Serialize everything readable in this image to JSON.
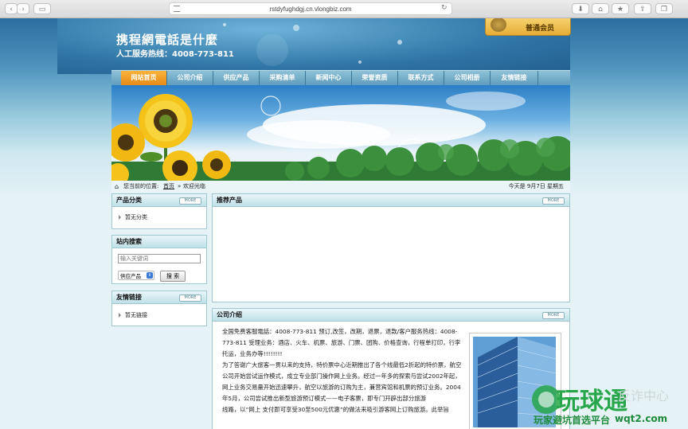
{
  "browser": {
    "url": "rstdyfughdgj.cn.vlongbiz.com"
  },
  "header": {
    "site_title": "携程網電話是什麼",
    "hotline": "人工服务热线：4008-773-811",
    "member_badge": "普通会员"
  },
  "nav": {
    "items": [
      "网站首页",
      "公司介绍",
      "供应产品",
      "采购清单",
      "新闻中心",
      "荣誉资质",
      "联系方式",
      "公司相册",
      "友情链接"
    ],
    "active_index": 0
  },
  "breadcrumb": {
    "prefix": "您当前的位置:",
    "home": "首页",
    "separator": "»",
    "current": "欢迎光临",
    "date_text": "今天是  9月7日  星期五"
  },
  "sidebar": {
    "categories": {
      "title": "产品分类",
      "more": "MORE",
      "items": [
        "暂无分类"
      ]
    },
    "search": {
      "title": "站内搜索",
      "placeholder": "输入关键词",
      "select_value": "供应产品",
      "button": "搜 索"
    },
    "links": {
      "title": "友情链接",
      "more": "MORE",
      "items": [
        "暂无链接"
      ]
    }
  },
  "main": {
    "recommended": {
      "title": "推荐产品",
      "more": "MORE"
    },
    "about": {
      "title": "公司介绍",
      "more": "MORE",
      "paragraphs": [
        "全国免费客服電話：4008-773-811 预订,改签，改期，退票，退款/客户服务热线：4008-773-811 受理业务：酒店、火车、机票、旅游、门票、团购、价格查询，行程单打印，行李托运，业务办等!!!!!!!!",
        "为了答谢广大旅客一贯以来的支持，特价票中心近期推出了各个线最低2折起的特价票，航空公司开始尝试运作模式，成立专业部门操作网上业务。经过一年多的探索与尝试2002年起，网上业务交易量开始迅速攀升，航空以旅游的订购为主，兼营宾馆和机票的预订业务。2004年5月，公司尝试推出新型旅游预订模式——电子客票，即专门开辟出部分旅游",
        "线路，以“网上 支付即可享受30至500元优惠”的做法来吸引游客网上订购旅游。此举旨"
      ]
    }
  },
  "watermark": {
    "brand": "玩球通",
    "tagline": "玩家避坑首选平台",
    "domain": "wqt2.com",
    "faded": "反诈中心"
  },
  "colors": {
    "nav_active": "#e78a16",
    "panel_border": "#9fc8d3",
    "watermark_green": "#27a64a"
  }
}
